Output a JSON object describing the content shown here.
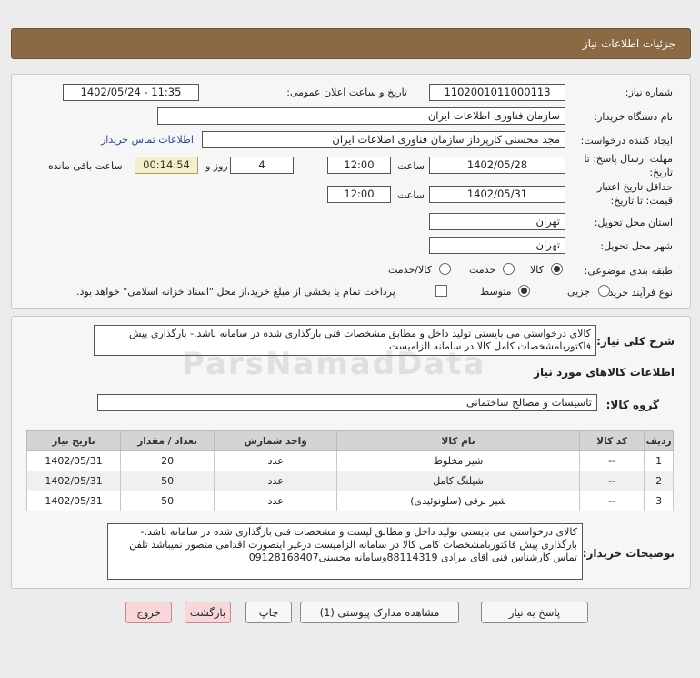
{
  "header": {
    "title": "جزئیات اطلاعات نیاز"
  },
  "form": {
    "need_number_label": "شماره نیاز:",
    "need_number": "1102001011000113",
    "announce_label": "تاریخ و ساعت اعلان عمومی:",
    "announce_value": "1402/05/24 - 11:35",
    "buyer_org_label": "نام دستگاه خریدار:",
    "buyer_org": "سازمان فناوری اطلاعات ایران",
    "creator_label": "ایجاد کننده درخواست:",
    "creator": "مجد محسنی کارپرداز سازمان فناوری اطلاعات ایران",
    "contact_link": "اطلاعات تماس خریدار",
    "reply_deadline_label_1": "مهلت ارسال پاسخ: تا",
    "reply_deadline_label_2": "تاریخ:",
    "reply_date": "1402/05/28",
    "time_label": "ساعت",
    "reply_time": "12:00",
    "days_value": "4",
    "days_label": "روز و",
    "remaining_time": "00:14:54",
    "remaining_label": "ساعت باقی مانده",
    "validity_label_1": "حداقل تاریخ اعتبار",
    "validity_label_2": "قیمت: تا تاریخ:",
    "validity_date": "1402/05/31",
    "validity_time": "12:00",
    "province_label": "استان محل تحویل:",
    "province": "تهران",
    "city_label": "شهر محل تحویل:",
    "city": "تهران",
    "category_label": "طبقه بندی موضوعی:",
    "category_options": [
      "کالا",
      "خدمت",
      "کالا/خدمت"
    ],
    "process_label": "نوع فرآیند خرید :",
    "process_options": [
      "جزیی",
      "متوسط"
    ],
    "payment_note": "پرداخت تمام یا بخشی از مبلغ خرید،از محل \"اسناد خزانه اسلامی\" خواهد بود."
  },
  "details": {
    "summary_label": "شرح کلی نیاز:",
    "summary": "کالای درخواستی می بایستی تولید داخل و مطابق مشخصات فنی بارگذاری شده در سامانه باشد.- بارگذاری پیش فاکتوربامشخصات کامل کالا در سامانه الزامیست",
    "goods_info_title": "اطلاعات کالاهای مورد نیاز",
    "goods_group_label": "گروه کالا:",
    "goods_group": "تاسیسات و مصالح ساختمانی",
    "buyer_notes_label": "توضیحات خریدار:",
    "buyer_notes": "کالای درخواستی می بایستی تولید داخل و مطابق لیست و مشخصات فنی بارگذاری شده در سامانه باشد.- بارگذاری پیش فاکتوربامشخصات کامل کالا در سامانه الزامیست درغیر اینصورت اقدامی متصور نمیباشد تلفن تماس کارشناس فنی آقای مرادی 88114319وسامانه محسنی09128168407"
  },
  "table": {
    "headers": [
      "ردیف",
      "کد کالا",
      "نام کالا",
      "واحد شمارش",
      "تعداد / مقدار",
      "تاریخ نیاز"
    ],
    "rows": [
      [
        "1",
        "--",
        "شیر مخلوط",
        "عدد",
        "20",
        "1402/05/31"
      ],
      [
        "2",
        "--",
        "شیلنگ کامل",
        "عدد",
        "50",
        "1402/05/31"
      ],
      [
        "3",
        "--",
        "شیر برقی (سلونوئیدی)",
        "عدد",
        "50",
        "1402/05/31"
      ]
    ]
  },
  "buttons": {
    "reply": "پاسخ به نیاز",
    "view_docs": "مشاهده مدارک پیوستی (1)",
    "print": "چاپ",
    "back": "بازگشت",
    "exit": "خروج"
  },
  "watermark": "ParsNamadData",
  "colors": {
    "titlebar": "#8a6a45",
    "timer_bg": "#f4efc8",
    "exit_bg": "#f7d7da",
    "link": "#2a4a9a"
  }
}
